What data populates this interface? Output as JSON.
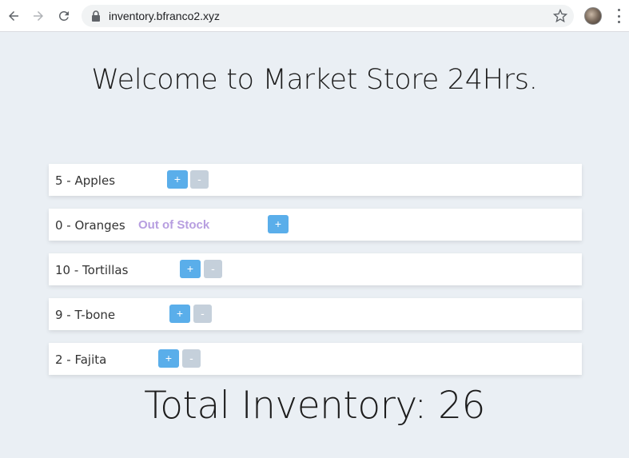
{
  "browser": {
    "url": "inventory.bfranco2.xyz"
  },
  "page": {
    "title": "Welcome to Market Store 24Hrs.",
    "total_label": "Total Inventory: 26"
  },
  "items": [
    {
      "label": "5 - Apples",
      "plus": "+",
      "minus": "-"
    },
    {
      "label": "0 - Oranges",
      "status": "Out of Stock",
      "plus": "+"
    },
    {
      "label": "10 - Tortillas",
      "plus": "+",
      "minus": "-"
    },
    {
      "label": "9 - T-bone",
      "plus": "+",
      "minus": "-"
    },
    {
      "label": "2 - Fajita",
      "plus": "+",
      "minus": "-"
    }
  ],
  "colors": {
    "background": "#eaeff4",
    "plus_button": "#5aaeea",
    "minus_button": "#c5d0db",
    "out_of_stock": "#b79ee0"
  }
}
